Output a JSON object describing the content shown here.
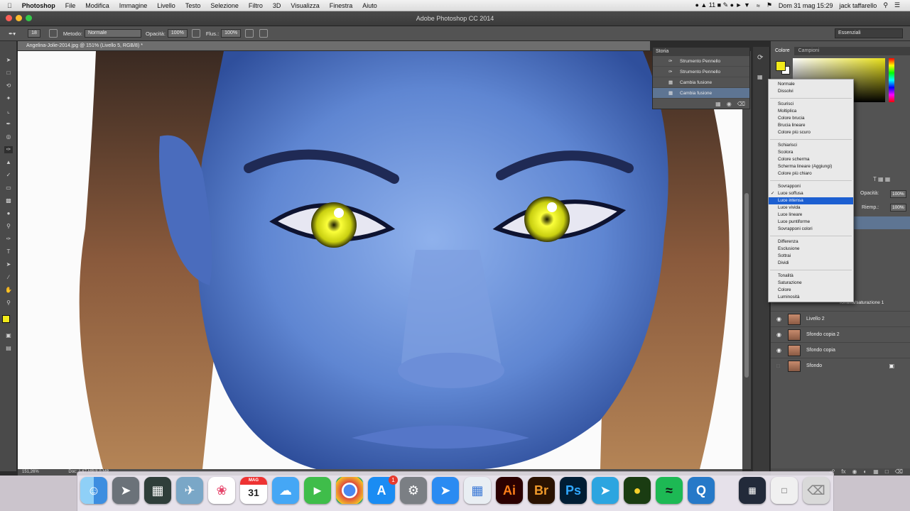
{
  "menubar": {
    "app": "Photoshop",
    "items": [
      "File",
      "Modifica",
      "Immagine",
      "Livello",
      "Testo",
      "Selezione",
      "Filtro",
      "3D",
      "Visualizza",
      "Finestra",
      "Aiuto"
    ],
    "right": {
      "badge": "11",
      "datetime": "Dom 31 mag 15:29",
      "user": "jack taffarello"
    }
  },
  "window_title": "Adobe Photoshop CC 2014",
  "options": {
    "brush_size": "18",
    "method_label": "Metodo:",
    "method_value": "Normale",
    "opacity_label": "Opacità:",
    "opacity_value": "100%",
    "flow_label": "Flus.:",
    "flow_value": "100%"
  },
  "workspace": "Essenziali",
  "document": {
    "tab": "Angelina-Jolie-2014.jpg @ 151% (Livello 5, RGB/8) *",
    "zoom": "151,26%",
    "doc_info": "Doc: 1,67 MB/8,9 MB"
  },
  "history": {
    "title": "Storia",
    "items": [
      "Strumento Pennello",
      "Strumento Pennello",
      "Cambia fusione",
      "Cambia fusione"
    ]
  },
  "color_panel": {
    "tabs": [
      "Colore",
      "Campioni"
    ],
    "fg": "#f2ea1a",
    "bg": "#ffffff"
  },
  "layers_panel": {
    "opacity_label": "Opacità:",
    "opacity_value": "100%",
    "fill_label": "Riemp.:",
    "fill_value": "100%",
    "partial_layer": "Tonalità/saturazione 1",
    "layers": [
      {
        "name": "Livello 2"
      },
      {
        "name": "Sfondo copia 2"
      },
      {
        "name": "Sfondo copia"
      },
      {
        "name": "Sfondo",
        "locked": true
      }
    ]
  },
  "blend_menu": {
    "groups": [
      [
        "Normale",
        "Dissolvi"
      ],
      [
        "Scurisci",
        "Moltiplica",
        "Colore brucia",
        "Brucia lineare",
        "Colore più scuro"
      ],
      [
        "Schiarisci",
        "Scolora",
        "Colore scherma",
        "Scherma lineare (Aggiungi)",
        "Colore più chiaro"
      ],
      [
        "Sovrapponi",
        "Luce soffusa",
        "Luce intensa",
        "Luce vivida",
        "Luce lineare",
        "Luce puntiforme",
        "Sovrapponi colori"
      ],
      [
        "Differenza",
        "Esclusione",
        "Sottrai",
        "Dividi"
      ],
      [
        "Tonalità",
        "Saturazione",
        "Colore",
        "Luminosità"
      ]
    ],
    "checked": "Luce soffusa",
    "highlighted": "Luce intensa"
  },
  "dock": {
    "calendar_month": "MAG",
    "calendar_day": "31",
    "appstore_badge": "1",
    "apps": [
      {
        "label": "Ai"
      },
      {
        "label": "Br"
      },
      {
        "label": "Ps"
      }
    ]
  }
}
